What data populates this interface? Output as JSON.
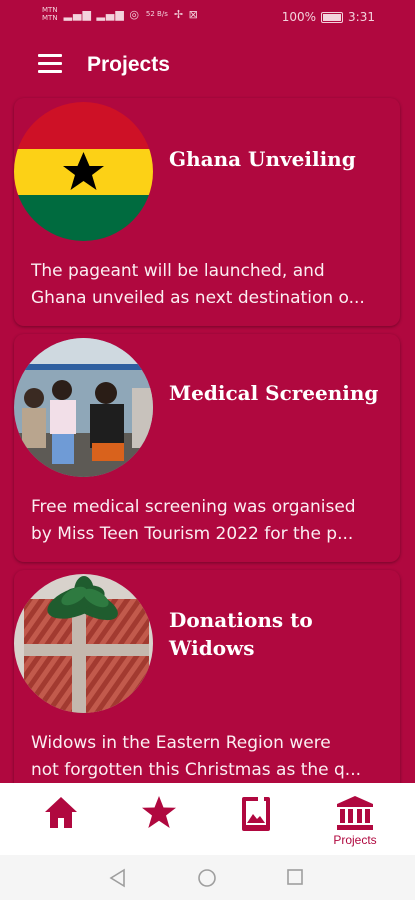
{
  "status_bar": {
    "carrier1": "MTN",
    "carrier2": "MTN",
    "net_speed": "52 B/s",
    "icons": "▏▐▐ ≡ ☩",
    "battery": "100%",
    "time": "3:31"
  },
  "app_bar": {
    "title": "Projects"
  },
  "projects": [
    {
      "title": "Ghana Unveiling",
      "desc_line1": "The pageant will be launched, and",
      "desc_line2": "Ghana unveiled as next destination o..."
    },
    {
      "title": "Medical Screening",
      "desc_line1": "Free medical screening was organised",
      "desc_line2": "by Miss Teen Tourism 2022 for the p..."
    },
    {
      "title_line1": "Donations to",
      "title_line2": "Widows",
      "desc_line1": "Widows in the Eastern Region were",
      "desc_line2": "not forgotten this Christmas as the q..."
    }
  ],
  "bottom_nav": {
    "items": [
      {
        "icon": "home-icon",
        "label": ""
      },
      {
        "icon": "star-icon",
        "label": ""
      },
      {
        "icon": "gallery-icon",
        "label": ""
      },
      {
        "icon": "institution-icon",
        "label": "Projects"
      }
    ],
    "active_color": "#b0083f"
  },
  "colors": {
    "brand": "#b0083f"
  }
}
